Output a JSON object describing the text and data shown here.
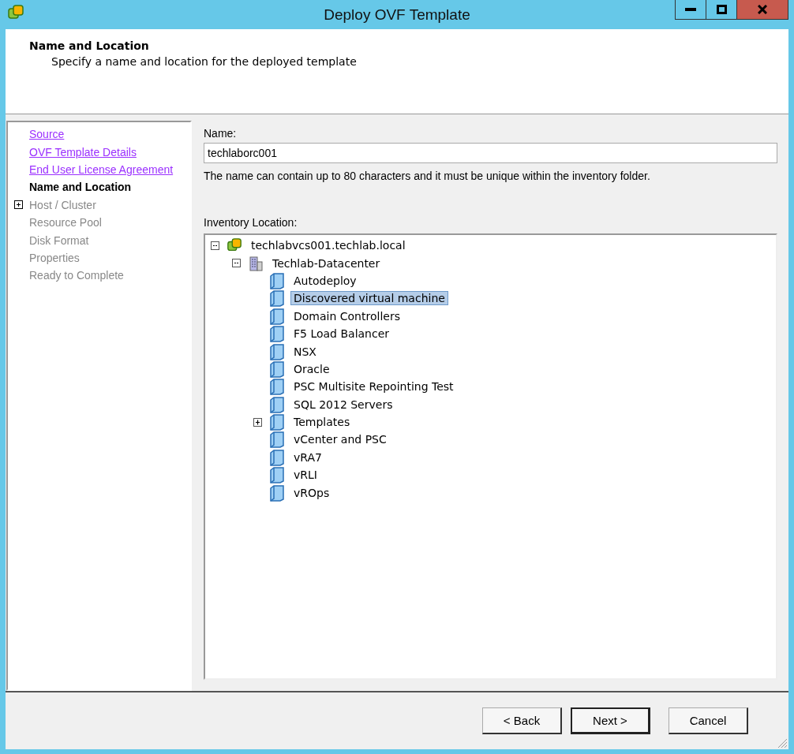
{
  "window": {
    "title": "Deploy OVF Template"
  },
  "header": {
    "title": "Name and Location",
    "subtitle": "Specify a name and location for the deployed template"
  },
  "steps": [
    {
      "label": "Source",
      "visited": true,
      "selected": false,
      "expandable": false
    },
    {
      "label": "OVF Template Details",
      "visited": true,
      "selected": false,
      "expandable": false
    },
    {
      "label": "End User License Agreement",
      "visited": true,
      "selected": false,
      "expandable": false
    },
    {
      "label": "Name and Location",
      "visited": false,
      "selected": true,
      "expandable": false
    },
    {
      "label": "Host / Cluster",
      "visited": false,
      "selected": false,
      "expandable": true
    },
    {
      "label": "Resource Pool",
      "visited": false,
      "selected": false,
      "expandable": false
    },
    {
      "label": "Disk Format",
      "visited": false,
      "selected": false,
      "expandable": false
    },
    {
      "label": "Properties",
      "visited": false,
      "selected": false,
      "expandable": false
    },
    {
      "label": "Ready to Complete",
      "visited": false,
      "selected": false,
      "expandable": false
    }
  ],
  "name_field": {
    "label": "Name:",
    "value": "techlaborc001",
    "hint": "The name can contain up to 80 characters and it must be unique within the inventory folder."
  },
  "inventory": {
    "label": "Inventory Location:",
    "tree": [
      {
        "label": "techlabvcs001.techlab.local",
        "kind": "vcenter",
        "expandable": true,
        "expanded": true,
        "selected": false,
        "children": [
          {
            "label": "Techlab-Datacenter",
            "kind": "datacenter",
            "expandable": true,
            "expanded": true,
            "selected": false,
            "children": [
              {
                "label": "Autodeploy",
                "kind": "folder",
                "expandable": false,
                "selected": false
              },
              {
                "label": "Discovered virtual machine",
                "kind": "folder",
                "expandable": false,
                "selected": true
              },
              {
                "label": "Domain Controllers",
                "kind": "folder",
                "expandable": false,
                "selected": false
              },
              {
                "label": "F5 Load Balancer",
                "kind": "folder",
                "expandable": false,
                "selected": false
              },
              {
                "label": "NSX",
                "kind": "folder",
                "expandable": false,
                "selected": false
              },
              {
                "label": "Oracle",
                "kind": "folder",
                "expandable": false,
                "selected": false
              },
              {
                "label": "PSC Multisite Repointing Test",
                "kind": "folder",
                "expandable": false,
                "selected": false
              },
              {
                "label": "SQL 2012 Servers",
                "kind": "folder",
                "expandable": false,
                "selected": false
              },
              {
                "label": "Templates",
                "kind": "folder",
                "expandable": true,
                "expanded": false,
                "selected": false
              },
              {
                "label": "vCenter and PSC",
                "kind": "folder",
                "expandable": false,
                "selected": false
              },
              {
                "label": "vRA7",
                "kind": "folder",
                "expandable": false,
                "selected": false
              },
              {
                "label": "vRLI",
                "kind": "folder",
                "expandable": false,
                "selected": false
              },
              {
                "label": "vROps",
                "kind": "folder",
                "expandable": false,
                "selected": false
              }
            ]
          }
        ]
      }
    ]
  },
  "buttons": [
    {
      "label": "< Back",
      "default": false
    },
    {
      "label": "Next >",
      "default": true
    },
    {
      "label": "Cancel",
      "default": false
    }
  ]
}
